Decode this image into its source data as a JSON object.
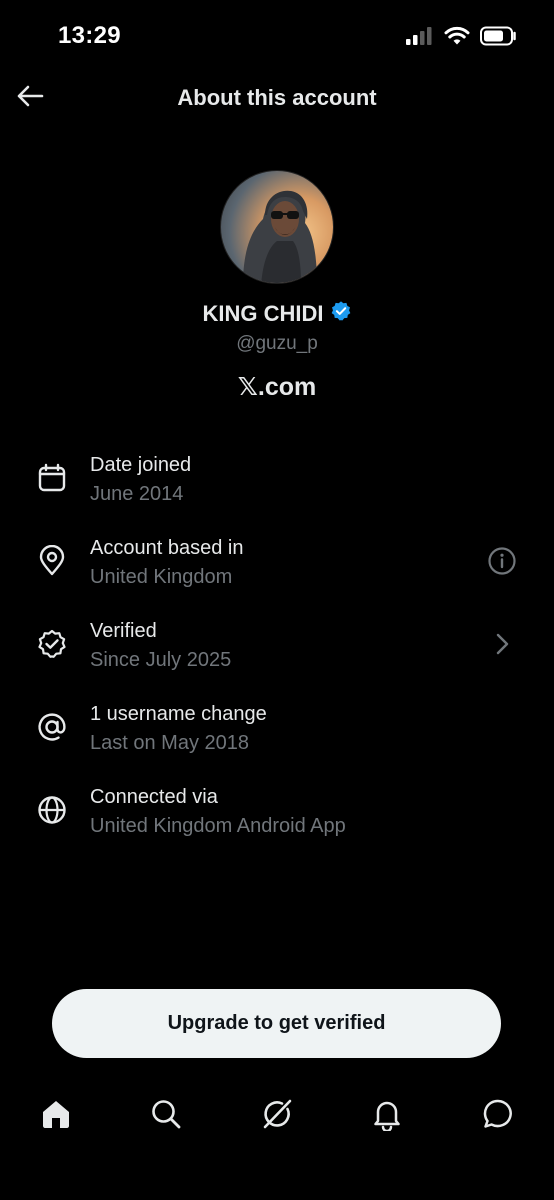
{
  "status_bar": {
    "time": "13:29",
    "icons": [
      "cellular-signal-icon",
      "wifi-icon",
      "battery-icon"
    ]
  },
  "header": {
    "title": "About this account",
    "back_icon": "arrow-left-icon"
  },
  "profile": {
    "display_name": "KING CHIDI",
    "verified_badge": "verified-badge-icon",
    "verified_color": "#1d9bf0",
    "handle": "@guzu_p",
    "platform": "𝕏.com"
  },
  "info": [
    {
      "icon": "calendar-icon",
      "title": "Date joined",
      "subtitle": "June 2014"
    },
    {
      "icon": "location-pin-icon",
      "title": "Account based in",
      "subtitle": "United Kingdom",
      "trailing": "info-icon"
    },
    {
      "icon": "verified-seal-icon",
      "title": "Verified",
      "subtitle": "Since July 2025",
      "trailing": "chevron-right-icon"
    },
    {
      "icon": "at-sign-icon",
      "title": "1 username change",
      "subtitle": "Last on May 2018"
    },
    {
      "icon": "globe-icon",
      "title": "Connected via",
      "subtitle": "United Kingdom Android App"
    }
  ],
  "upgrade_button": {
    "label": "Upgrade to get verified"
  },
  "bottom_nav": [
    "home-icon",
    "search-icon",
    "grok-icon",
    "notifications-bell-icon",
    "messages-icon"
  ],
  "colors": {
    "background": "#000000",
    "primary_text": "#e7e9ea",
    "secondary_text": "#71767b",
    "button_bg": "#eff3f4"
  }
}
